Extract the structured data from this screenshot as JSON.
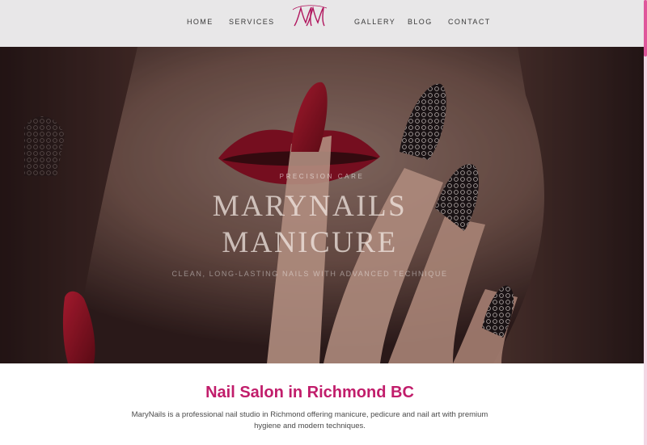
{
  "header": {
    "nav": [
      {
        "label": "HOME"
      },
      {
        "label": "SERVICES"
      },
      {
        "label": "GALLERY"
      },
      {
        "label": "BLOG"
      },
      {
        "label": "CONTACT"
      }
    ],
    "logo_text": "MM"
  },
  "hero": {
    "kicker": "PRECISION CARE",
    "title_line1": "MARYNAILS",
    "title_line2": "MANICURE",
    "subtitle": "CLEAN, LONG-LASTING NAILS WITH ADVANCED TECHNIQUE"
  },
  "intro": {
    "title": "Nail Salon in Richmond BC",
    "text": "MaryNails is a professional nail studio in Richmond offering manicure, pedicure and nail art with premium hygiene and modern techniques."
  },
  "colors": {
    "brand": "#c11d6b",
    "header_bg": "#e8e7e8",
    "scroll_accent": "#e0569b"
  }
}
